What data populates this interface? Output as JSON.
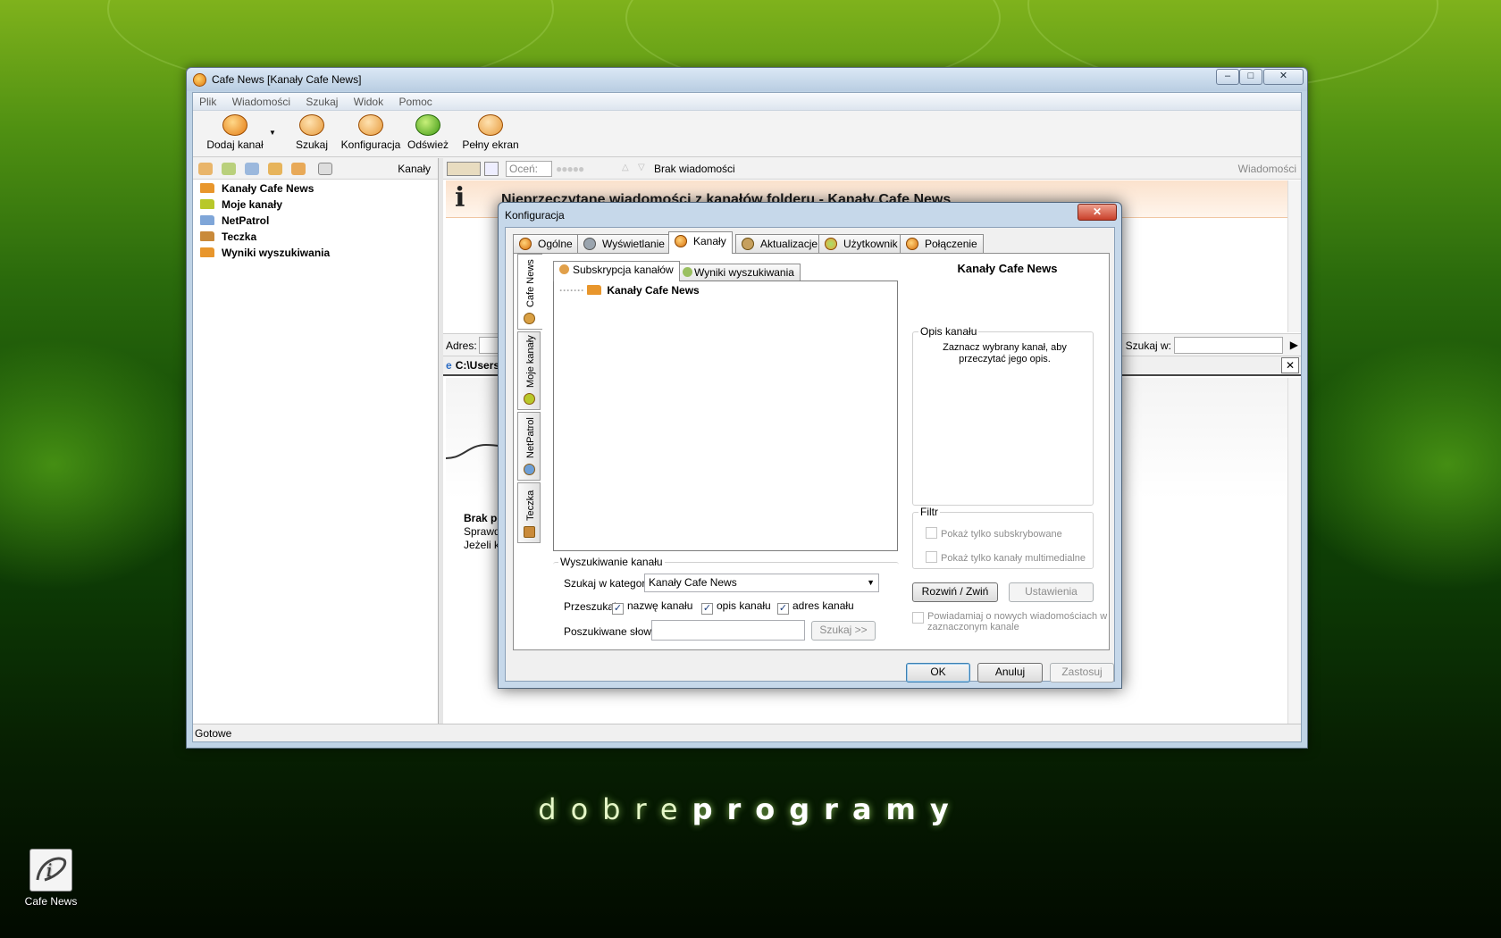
{
  "desktop": {
    "brand_light": "dobre",
    "brand_bold": "programy",
    "icon_label": "Cafe News"
  },
  "window": {
    "title": "Cafe News [Kanały Cafe News]",
    "controls": {
      "minimize": "–",
      "maximize": "□",
      "close": "✕"
    },
    "menu": [
      "Plik",
      "Wiadomości",
      "Szukaj",
      "Widok",
      "Pomoc"
    ],
    "toolbar": [
      {
        "label": "Dodaj kanał",
        "icon": "add-channel-icon"
      },
      {
        "label": "Szukaj",
        "icon": "search-icon"
      },
      {
        "label": "Konfiguracja",
        "icon": "settings-icon"
      },
      {
        "label": "Odśwież",
        "icon": "refresh-icon"
      },
      {
        "label": "Pełny ekran",
        "icon": "fullscreen-icon"
      }
    ],
    "left_pane": {
      "header_label": "Kanały",
      "tree": [
        {
          "label": "Kanały Cafe News",
          "color": "#e8962c"
        },
        {
          "label": "Moje kanały",
          "color": "#b8c82a"
        },
        {
          "label": "NetPatrol",
          "color": "#7fa6d8"
        },
        {
          "label": "Teczka",
          "color": "#c98a3a"
        },
        {
          "label": "Wyniki wyszukiwania",
          "color": "#e8962c"
        }
      ]
    },
    "right_pane": {
      "rate_label": "Oceń:",
      "no_messages": "Brak wiadomości",
      "header_label": "Wiadomości",
      "banner_text": "Nieprzeczytane wiadomości z kanałów folderu - Kanały Cafe News",
      "address_label": "Adres:",
      "search_in_label": "Szukaj w:",
      "tab_path": "C:\\Users",
      "body_lines": [
        "Brak po",
        "Sprawdź",
        "Jeżeli ko"
      ]
    },
    "status": "Gotowe"
  },
  "dialog": {
    "title": "Konfiguracja",
    "close": "✕",
    "tabs": [
      "Ogólne",
      "Wyświetlanie",
      "Kanały",
      "Aktualizacje",
      "Użytkownik",
      "Połączenie"
    ],
    "active_tab": "Kanały",
    "side_tabs": [
      "Cafe News",
      "Moje kanały",
      "NetPatrol",
      "Teczka"
    ],
    "sub_tabs": [
      "Subskrypcja kanałów",
      "Wyniki wyszukiwania"
    ],
    "tree_root": "Kanały Cafe News",
    "channel_title": "Kanały Cafe News",
    "description": {
      "legend": "Opis kanału",
      "text": "Zaznacz wybrany kanał, aby przeczytać jego opis."
    },
    "filter": {
      "legend": "Filtr",
      "only_subscribed": "Pokaż tylko subskrybowane",
      "only_multimedia": "Pokaż tylko kanały multimedialne"
    },
    "expand_button": "Rozwiń / Zwiń",
    "settings_button": "Ustawienia",
    "notify": "Powiadamiaj o nowych wiadomościach w zaznaczonym kanale",
    "search": {
      "legend": "Wyszukiwanie kanału",
      "category_label": "Szukaj w kategorii:",
      "category_value": "Kanały Cafe News",
      "search_in_label": "Przeszukaj:",
      "opt_name": "nazwę kanału",
      "opt_desc": "opis kanału",
      "opt_addr": "adres kanału",
      "word_label": "Poszukiwane słowo:",
      "word_value": "",
      "search_button": "Szukaj >>"
    },
    "ok": "OK",
    "cancel": "Anuluj",
    "apply": "Zastosuj"
  }
}
